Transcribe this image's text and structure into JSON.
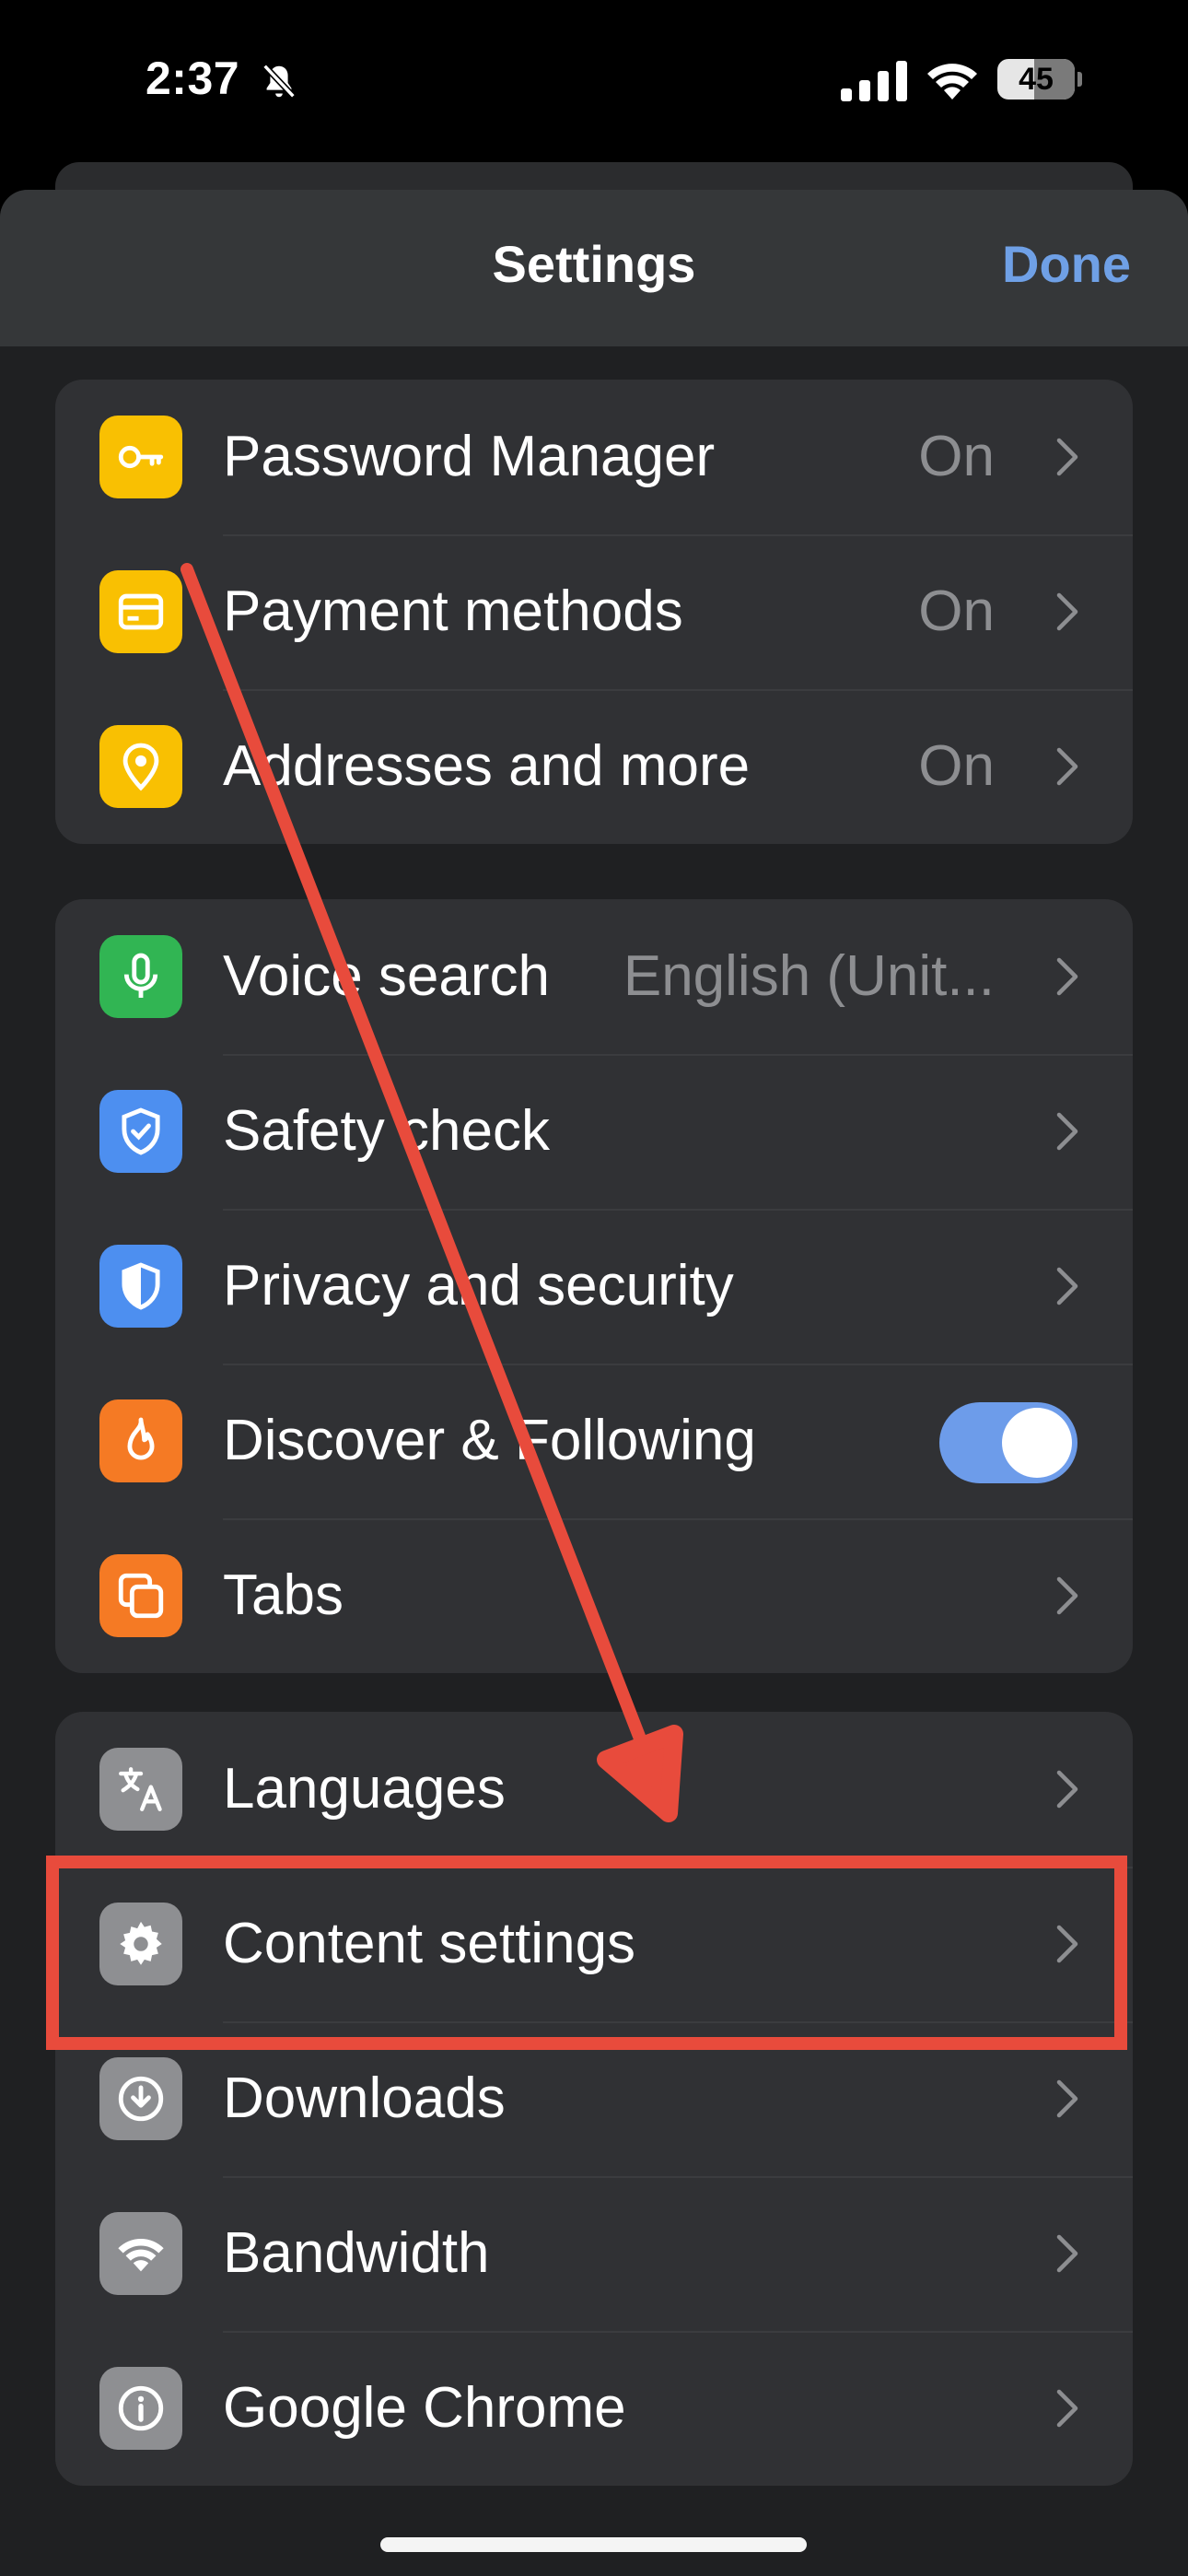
{
  "status_bar": {
    "time": "2:37",
    "battery": "45",
    "icons": [
      "bell-slash-icon",
      "cellular-signal-icon",
      "wifi-icon",
      "battery-icon"
    ]
  },
  "header": {
    "title": "Settings",
    "done_label": "Done"
  },
  "groups": [
    {
      "items": [
        {
          "label": "Password Manager",
          "value": "On",
          "icon": "key-icon",
          "icon_color": "#f9c002"
        },
        {
          "label": "Payment methods",
          "value": "On",
          "icon": "credit-card-icon",
          "icon_color": "#f9c002"
        },
        {
          "label": "Addresses and more",
          "value": "On",
          "icon": "location-pin-icon",
          "icon_color": "#f9c002"
        }
      ]
    },
    {
      "items": [
        {
          "label": "Voice search",
          "value": "English (Unit...",
          "icon": "microphone-icon",
          "icon_color": "#31b553"
        },
        {
          "label": "Safety check",
          "icon": "shield-check-icon",
          "icon_color": "#4d8ff0"
        },
        {
          "label": "Privacy and security",
          "icon": "shield-icon",
          "icon_color": "#4d8ff0"
        },
        {
          "label": "Discover & Following",
          "icon": "flame-icon",
          "icon_color": "#f57a24",
          "toggle_on": true
        },
        {
          "label": "Tabs",
          "icon": "tabs-icon",
          "icon_color": "#f57a24"
        }
      ]
    },
    {
      "items": [
        {
          "label": "Languages",
          "icon": "translate-icon",
          "icon_color": "#8e8f92"
        },
        {
          "label": "Content settings",
          "icon": "gear-icon",
          "icon_color": "#8e8f92"
        },
        {
          "label": "Downloads",
          "icon": "download-icon",
          "icon_color": "#8e8f92"
        },
        {
          "label": "Bandwidth",
          "icon": "wifi-icon",
          "icon_color": "#8e8f92"
        },
        {
          "label": "Google Chrome",
          "icon": "info-icon",
          "icon_color": "#8e8f92"
        }
      ]
    }
  ],
  "colors": {
    "accent": "#6fa0e6",
    "annotation_red": "#e84b3c",
    "background": "#1f2022",
    "card": "#303134"
  }
}
